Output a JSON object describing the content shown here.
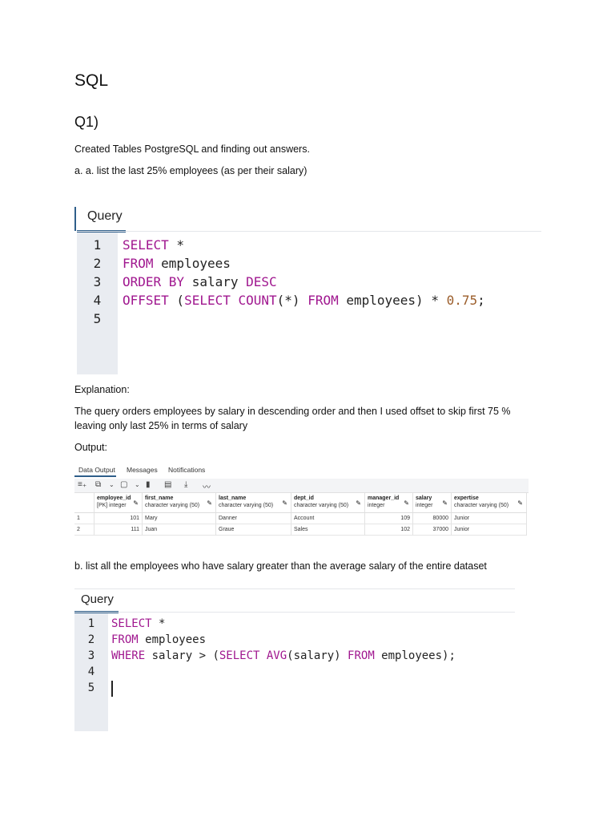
{
  "title": "SQL",
  "question": "Q1)",
  "intro": "Created Tables PostgreSQL and finding out answers.",
  "part_a": "a. a. list the last 25% employees (as per their salary)",
  "query1": {
    "tab": "Query",
    "line_numbers": [
      "1",
      "2",
      "3",
      "4",
      "5"
    ],
    "lines": [
      [
        [
          "kw",
          "SELECT"
        ],
        [
          "id",
          " *"
        ]
      ],
      [
        [
          "kw",
          "FROM"
        ],
        [
          "id",
          " employees"
        ]
      ],
      [
        [
          "kw",
          "ORDER BY"
        ],
        [
          "id",
          " salary "
        ],
        [
          "kw",
          "DESC"
        ]
      ],
      [
        [
          "kw",
          "OFFSET"
        ],
        [
          "id",
          " ("
        ],
        [
          "kw",
          "SELECT COUNT"
        ],
        [
          "id",
          "(*) "
        ],
        [
          "kw",
          "FROM"
        ],
        [
          "id",
          " employees) * "
        ],
        [
          "num",
          "0.75"
        ],
        [
          "id",
          ";"
        ]
      ],
      []
    ]
  },
  "explanation_label": "Explanation:",
  "explanation": "The query orders employees by salary in descending order and then I used offset to skip first 75 % leaving only last 25% in terms of salary",
  "output_label": "Output:",
  "result": {
    "tabs": [
      "Data Output",
      "Messages",
      "Notifications"
    ],
    "columns": [
      {
        "name": "employee_id",
        "type": "[PK] integer"
      },
      {
        "name": "first_name",
        "type": "character varying (50)"
      },
      {
        "name": "last_name",
        "type": "character varying (50)"
      },
      {
        "name": "dept_id",
        "type": "character varying (50)"
      },
      {
        "name": "manager_id",
        "type": "integer"
      },
      {
        "name": "salary",
        "type": "integer"
      },
      {
        "name": "expertise",
        "type": "character varying (50)"
      }
    ],
    "rows": [
      [
        "1",
        "101",
        "Mary",
        "Danner",
        "Account",
        "109",
        "80000",
        "Junior"
      ],
      [
        "2",
        "111",
        "Juan",
        "Graue",
        "Sales",
        "102",
        "37000",
        "Junior"
      ]
    ]
  },
  "part_b": "b. list all the employees who have salary greater than the average salary of the entire dataset",
  "query2": {
    "tab": "Query",
    "line_numbers": [
      "1",
      "2",
      "3",
      "4",
      "5"
    ],
    "lines": [
      [
        [
          "kw",
          "SELECT"
        ],
        [
          "id",
          " *"
        ]
      ],
      [
        [
          "kw",
          "FROM"
        ],
        [
          "id",
          " employees"
        ]
      ],
      [
        [
          "kw",
          "WHERE"
        ],
        [
          "id",
          " salary > ("
        ],
        [
          "kw",
          "SELECT AVG"
        ],
        [
          "id",
          "(salary) "
        ],
        [
          "kw",
          "FROM"
        ],
        [
          "id",
          " employees);"
        ]
      ],
      [],
      []
    ]
  }
}
